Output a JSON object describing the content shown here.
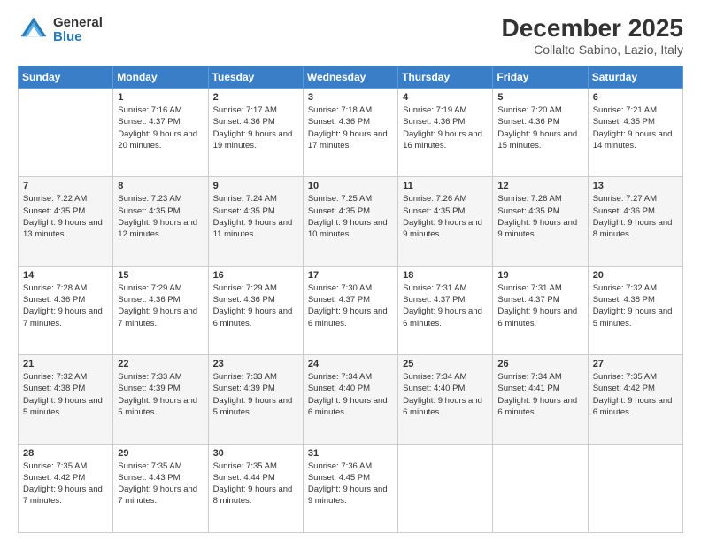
{
  "header": {
    "logo_general": "General",
    "logo_blue": "Blue",
    "month_title": "December 2025",
    "location": "Collalto Sabino, Lazio, Italy"
  },
  "days_of_week": [
    "Sunday",
    "Monday",
    "Tuesday",
    "Wednesday",
    "Thursday",
    "Friday",
    "Saturday"
  ],
  "weeks": [
    [
      {
        "day": "",
        "sunrise": "",
        "sunset": "",
        "daylight": ""
      },
      {
        "day": "1",
        "sunrise": "Sunrise: 7:16 AM",
        "sunset": "Sunset: 4:37 PM",
        "daylight": "Daylight: 9 hours and 20 minutes."
      },
      {
        "day": "2",
        "sunrise": "Sunrise: 7:17 AM",
        "sunset": "Sunset: 4:36 PM",
        "daylight": "Daylight: 9 hours and 19 minutes."
      },
      {
        "day": "3",
        "sunrise": "Sunrise: 7:18 AM",
        "sunset": "Sunset: 4:36 PM",
        "daylight": "Daylight: 9 hours and 17 minutes."
      },
      {
        "day": "4",
        "sunrise": "Sunrise: 7:19 AM",
        "sunset": "Sunset: 4:36 PM",
        "daylight": "Daylight: 9 hours and 16 minutes."
      },
      {
        "day": "5",
        "sunrise": "Sunrise: 7:20 AM",
        "sunset": "Sunset: 4:36 PM",
        "daylight": "Daylight: 9 hours and 15 minutes."
      },
      {
        "day": "6",
        "sunrise": "Sunrise: 7:21 AM",
        "sunset": "Sunset: 4:35 PM",
        "daylight": "Daylight: 9 hours and 14 minutes."
      }
    ],
    [
      {
        "day": "7",
        "sunrise": "Sunrise: 7:22 AM",
        "sunset": "Sunset: 4:35 PM",
        "daylight": "Daylight: 9 hours and 13 minutes."
      },
      {
        "day": "8",
        "sunrise": "Sunrise: 7:23 AM",
        "sunset": "Sunset: 4:35 PM",
        "daylight": "Daylight: 9 hours and 12 minutes."
      },
      {
        "day": "9",
        "sunrise": "Sunrise: 7:24 AM",
        "sunset": "Sunset: 4:35 PM",
        "daylight": "Daylight: 9 hours and 11 minutes."
      },
      {
        "day": "10",
        "sunrise": "Sunrise: 7:25 AM",
        "sunset": "Sunset: 4:35 PM",
        "daylight": "Daylight: 9 hours and 10 minutes."
      },
      {
        "day": "11",
        "sunrise": "Sunrise: 7:26 AM",
        "sunset": "Sunset: 4:35 PM",
        "daylight": "Daylight: 9 hours and 9 minutes."
      },
      {
        "day": "12",
        "sunrise": "Sunrise: 7:26 AM",
        "sunset": "Sunset: 4:35 PM",
        "daylight": "Daylight: 9 hours and 9 minutes."
      },
      {
        "day": "13",
        "sunrise": "Sunrise: 7:27 AM",
        "sunset": "Sunset: 4:36 PM",
        "daylight": "Daylight: 9 hours and 8 minutes."
      }
    ],
    [
      {
        "day": "14",
        "sunrise": "Sunrise: 7:28 AM",
        "sunset": "Sunset: 4:36 PM",
        "daylight": "Daylight: 9 hours and 7 minutes."
      },
      {
        "day": "15",
        "sunrise": "Sunrise: 7:29 AM",
        "sunset": "Sunset: 4:36 PM",
        "daylight": "Daylight: 9 hours and 7 minutes."
      },
      {
        "day": "16",
        "sunrise": "Sunrise: 7:29 AM",
        "sunset": "Sunset: 4:36 PM",
        "daylight": "Daylight: 9 hours and 6 minutes."
      },
      {
        "day": "17",
        "sunrise": "Sunrise: 7:30 AM",
        "sunset": "Sunset: 4:37 PM",
        "daylight": "Daylight: 9 hours and 6 minutes."
      },
      {
        "day": "18",
        "sunrise": "Sunrise: 7:31 AM",
        "sunset": "Sunset: 4:37 PM",
        "daylight": "Daylight: 9 hours and 6 minutes."
      },
      {
        "day": "19",
        "sunrise": "Sunrise: 7:31 AM",
        "sunset": "Sunset: 4:37 PM",
        "daylight": "Daylight: 9 hours and 6 minutes."
      },
      {
        "day": "20",
        "sunrise": "Sunrise: 7:32 AM",
        "sunset": "Sunset: 4:38 PM",
        "daylight": "Daylight: 9 hours and 5 minutes."
      }
    ],
    [
      {
        "day": "21",
        "sunrise": "Sunrise: 7:32 AM",
        "sunset": "Sunset: 4:38 PM",
        "daylight": "Daylight: 9 hours and 5 minutes."
      },
      {
        "day": "22",
        "sunrise": "Sunrise: 7:33 AM",
        "sunset": "Sunset: 4:39 PM",
        "daylight": "Daylight: 9 hours and 5 minutes."
      },
      {
        "day": "23",
        "sunrise": "Sunrise: 7:33 AM",
        "sunset": "Sunset: 4:39 PM",
        "daylight": "Daylight: 9 hours and 5 minutes."
      },
      {
        "day": "24",
        "sunrise": "Sunrise: 7:34 AM",
        "sunset": "Sunset: 4:40 PM",
        "daylight": "Daylight: 9 hours and 6 minutes."
      },
      {
        "day": "25",
        "sunrise": "Sunrise: 7:34 AM",
        "sunset": "Sunset: 4:40 PM",
        "daylight": "Daylight: 9 hours and 6 minutes."
      },
      {
        "day": "26",
        "sunrise": "Sunrise: 7:34 AM",
        "sunset": "Sunset: 4:41 PM",
        "daylight": "Daylight: 9 hours and 6 minutes."
      },
      {
        "day": "27",
        "sunrise": "Sunrise: 7:35 AM",
        "sunset": "Sunset: 4:42 PM",
        "daylight": "Daylight: 9 hours and 6 minutes."
      }
    ],
    [
      {
        "day": "28",
        "sunrise": "Sunrise: 7:35 AM",
        "sunset": "Sunset: 4:42 PM",
        "daylight": "Daylight: 9 hours and 7 minutes."
      },
      {
        "day": "29",
        "sunrise": "Sunrise: 7:35 AM",
        "sunset": "Sunset: 4:43 PM",
        "daylight": "Daylight: 9 hours and 7 minutes."
      },
      {
        "day": "30",
        "sunrise": "Sunrise: 7:35 AM",
        "sunset": "Sunset: 4:44 PM",
        "daylight": "Daylight: 9 hours and 8 minutes."
      },
      {
        "day": "31",
        "sunrise": "Sunrise: 7:36 AM",
        "sunset": "Sunset: 4:45 PM",
        "daylight": "Daylight: 9 hours and 9 minutes."
      },
      {
        "day": "",
        "sunrise": "",
        "sunset": "",
        "daylight": ""
      },
      {
        "day": "",
        "sunrise": "",
        "sunset": "",
        "daylight": ""
      },
      {
        "day": "",
        "sunrise": "",
        "sunset": "",
        "daylight": ""
      }
    ]
  ]
}
